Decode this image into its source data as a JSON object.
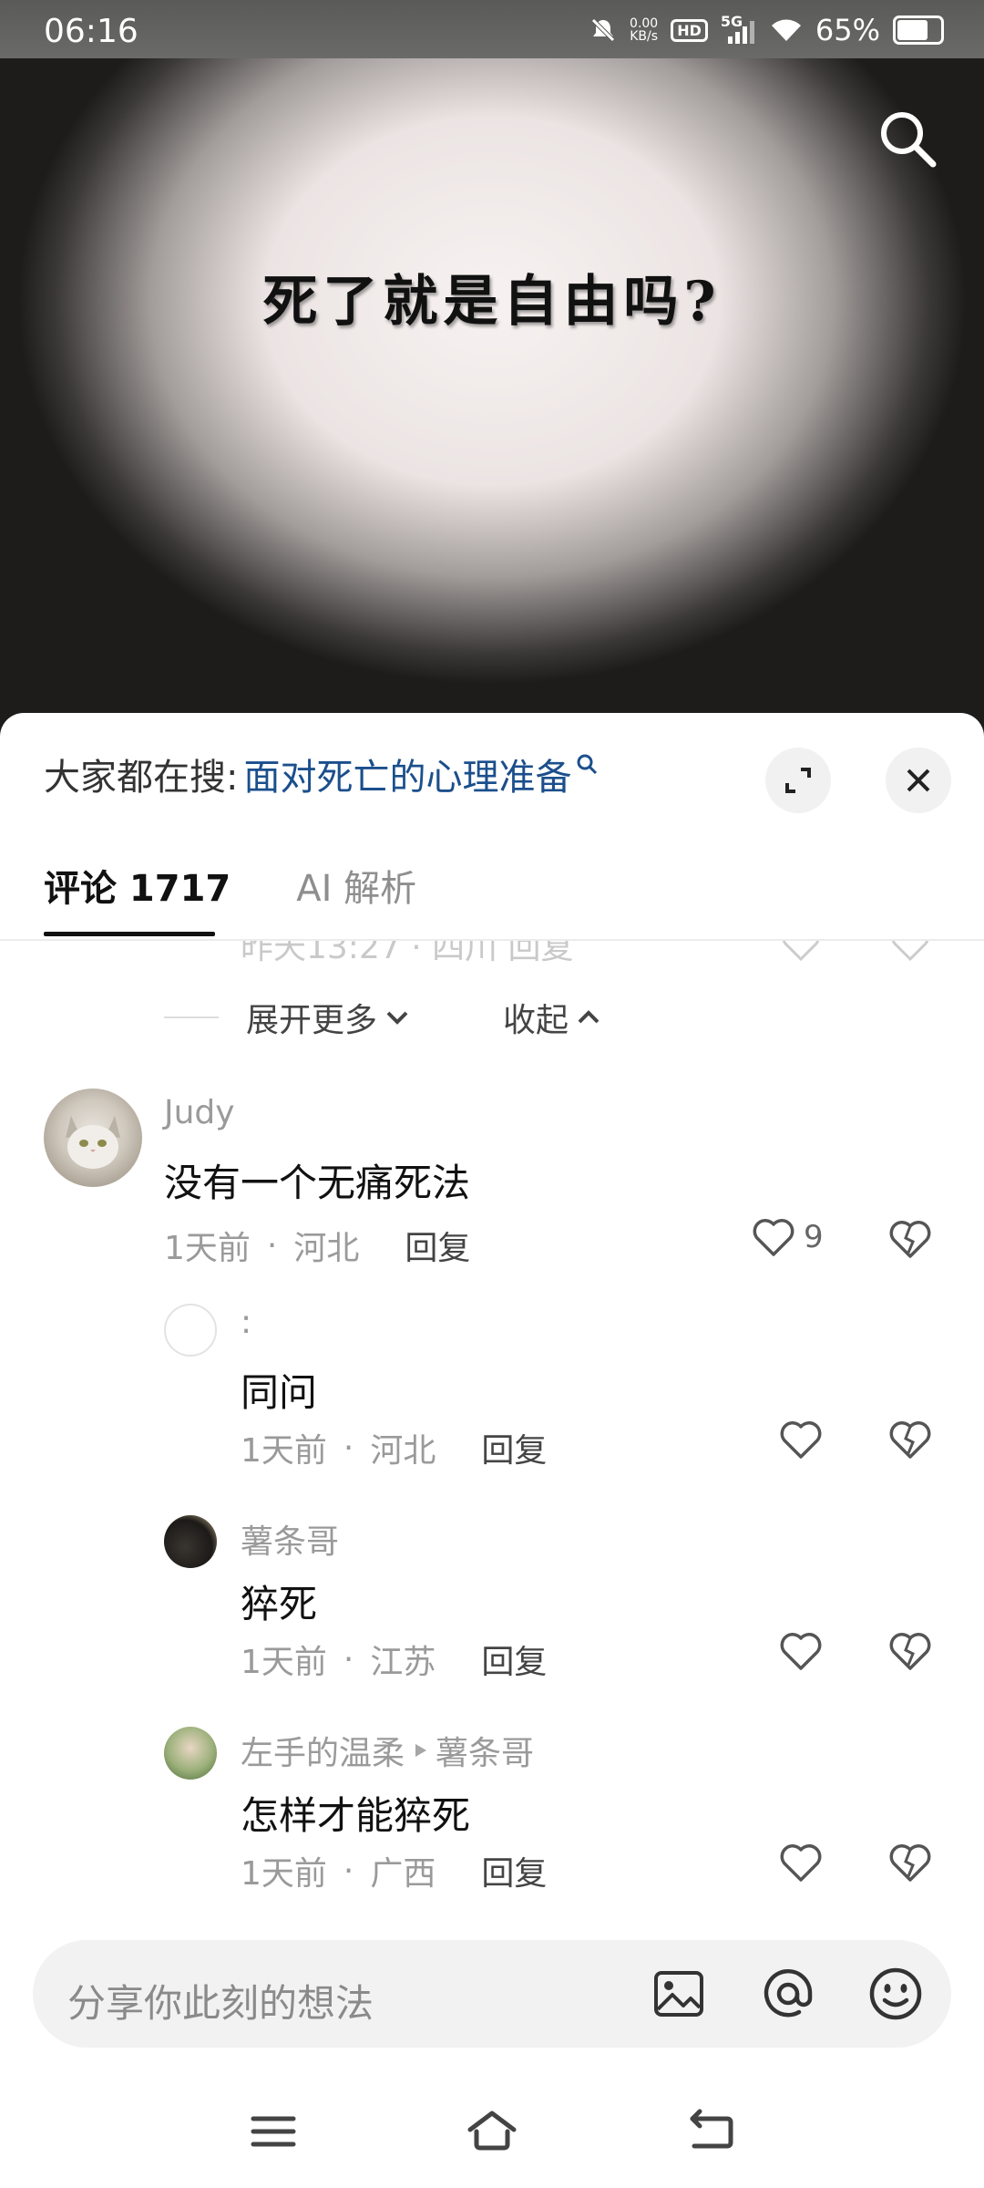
{
  "status_bar": {
    "time": "06:16",
    "net_speed_value": "0.00",
    "net_speed_unit": "KB/s",
    "hd": "HD",
    "network": "5G",
    "battery": "65%"
  },
  "video": {
    "caption": "死了就是自由吗?"
  },
  "sheet": {
    "hot_search_label": "大家都在搜:",
    "hot_search_query": "面对死亡的心理准备",
    "tabs": [
      {
        "label": "评论 1717"
      },
      {
        "label": "AI 解析"
      }
    ],
    "partial_row_text": "昨天13:27 · 四川  回复",
    "expand_more": "展开更多",
    "collapse": "收起"
  },
  "comments": [
    {
      "author": "Judy",
      "text": "没有一个无痛死法",
      "time": "1天前",
      "location": "河北",
      "reply": "回复",
      "likes": "9"
    }
  ],
  "replies": [
    {
      "author": ":",
      "text": "同问",
      "time": "1天前",
      "location": "河北",
      "reply": "回复"
    },
    {
      "author": "薯条哥",
      "text": "猝死",
      "time": "1天前",
      "location": "江苏",
      "reply": "回复"
    },
    {
      "author": "左手的温柔",
      "reply_to": "薯条哥",
      "text": "怎样才能猝死",
      "time": "1天前",
      "location": "广西",
      "reply": "回复"
    }
  ],
  "input_bar": {
    "placeholder": "分享你此刻的想法"
  },
  "icons": {
    "search": "search-icon",
    "expand": "expand-icon",
    "close": "close-icon",
    "like": "heart-icon",
    "unlike": "broken-heart-icon",
    "image": "image-icon",
    "mention": "at-icon",
    "emoji": "emoji-icon",
    "menu": "menu-icon",
    "home": "home-icon",
    "back": "back-icon"
  }
}
